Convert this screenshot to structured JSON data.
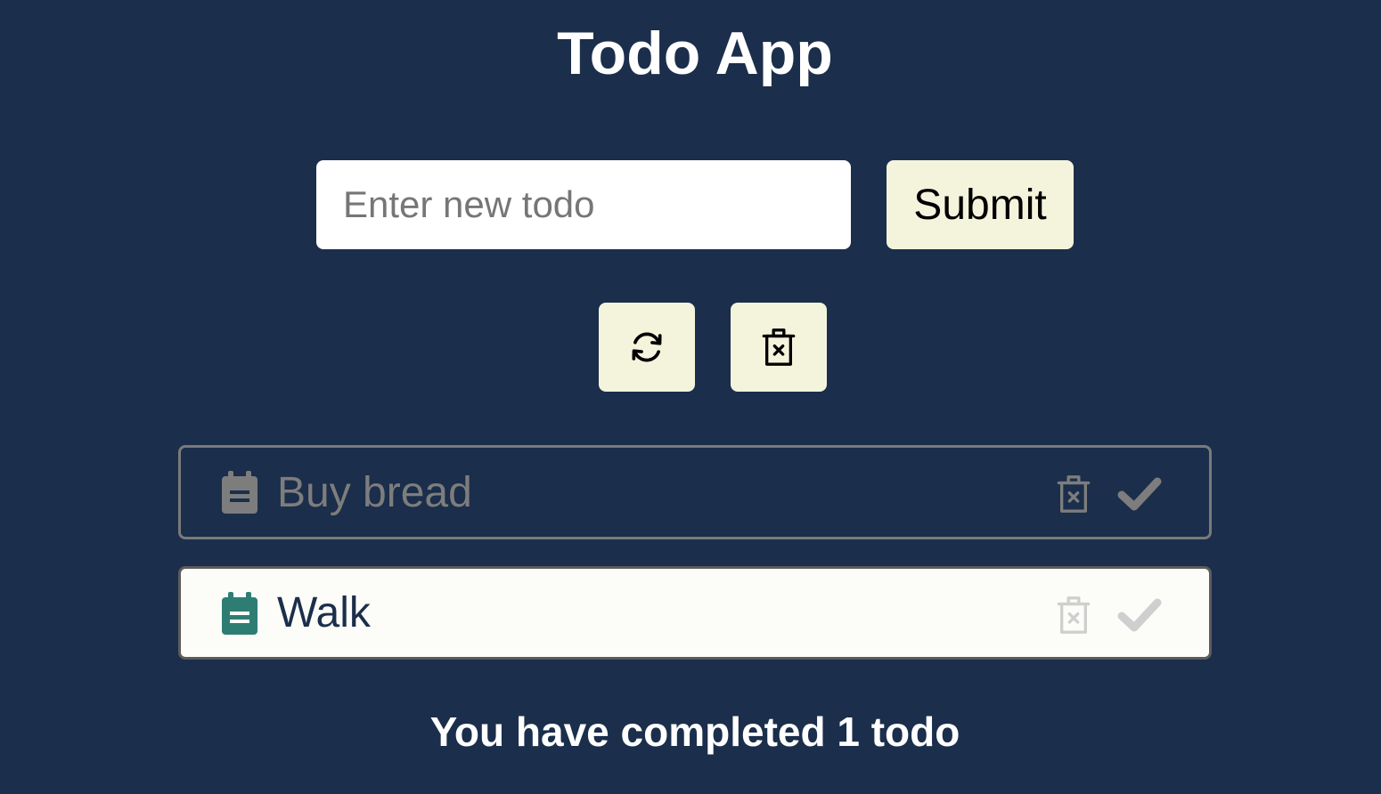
{
  "app": {
    "title": "Todo App"
  },
  "form": {
    "input_value": "",
    "input_placeholder": "Enter new todo",
    "submit_label": "Submit"
  },
  "actions": {
    "refresh_icon": "refresh-icon",
    "clear_all_icon": "delete-all-icon"
  },
  "todos": [
    {
      "label": "Buy bread",
      "completed": true,
      "icon": "clipboard-icon"
    },
    {
      "label": "Walk",
      "completed": false,
      "icon": "clipboard-icon"
    }
  ],
  "colors": {
    "background": "#1b2e4b",
    "button": "#f4f4dc",
    "note_active": "#2e7d72",
    "note_done": "#7d7d7d"
  },
  "summary": {
    "text": "You have completed 1 todo"
  }
}
